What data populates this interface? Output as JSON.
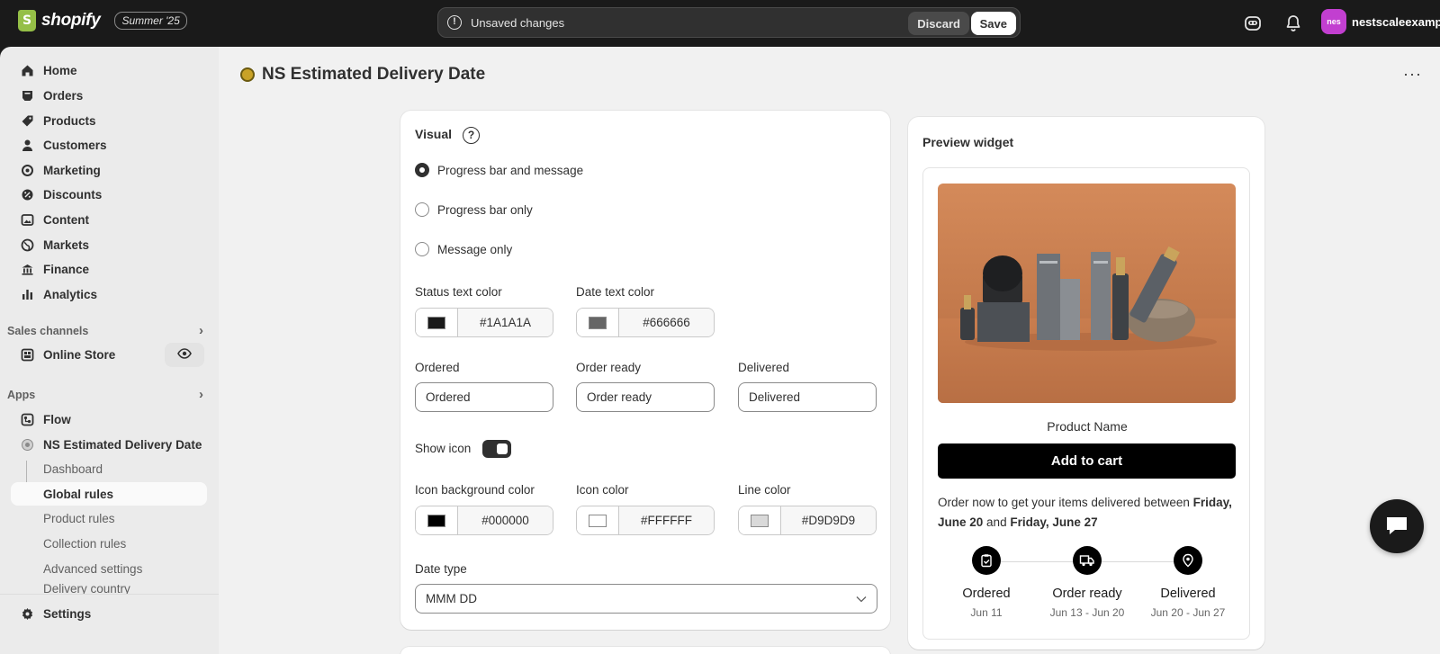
{
  "topbar": {
    "logo_text": "shopify",
    "edition": "Summer '25",
    "unsaved_message": "Unsaved changes",
    "discard_label": "Discard",
    "save_label": "Save",
    "store_avatar": "nes",
    "store_name": "nestscaleexample"
  },
  "sidebar": {
    "items": [
      {
        "label": "Home",
        "icon": "home-icon"
      },
      {
        "label": "Orders",
        "icon": "orders-icon"
      },
      {
        "label": "Products",
        "icon": "tag-icon"
      },
      {
        "label": "Customers",
        "icon": "person-icon"
      },
      {
        "label": "Marketing",
        "icon": "target-icon"
      },
      {
        "label": "Discounts",
        "icon": "discount-icon"
      },
      {
        "label": "Content",
        "icon": "content-icon"
      },
      {
        "label": "Markets",
        "icon": "globe-icon"
      },
      {
        "label": "Finance",
        "icon": "bank-icon"
      },
      {
        "label": "Analytics",
        "icon": "chart-icon"
      }
    ],
    "sales_channels_label": "Sales channels",
    "online_store_label": "Online Store",
    "apps_label": "Apps",
    "flow_label": "Flow",
    "app_label": "NS Estimated Delivery Date",
    "sub_items": [
      "Dashboard",
      "Global rules",
      "Product rules",
      "Collection rules",
      "Advanced settings",
      "Delivery country"
    ],
    "settings_label": "Settings"
  },
  "page": {
    "title": "NS Estimated Delivery Date"
  },
  "visual": {
    "heading": "Visual",
    "options": [
      "Progress bar and message",
      "Progress bar only",
      "Message only"
    ],
    "selected": 0,
    "status_text_color_label": "Status text color",
    "status_text_color": "#1A1A1A",
    "date_text_color_label": "Date text color",
    "date_text_color": "#666666",
    "ordered_label": "Ordered",
    "ordered_value": "Ordered",
    "order_ready_label": "Order ready",
    "order_ready_value": "Order ready",
    "delivered_label": "Delivered",
    "delivered_value": "Delivered",
    "show_icon_label": "Show icon",
    "show_icon_on": true,
    "icon_bg_color_label": "Icon background color",
    "icon_bg_color": "#000000",
    "icon_color_label": "Icon color",
    "icon_color": "#FFFFFF",
    "line_color_label": "Line color",
    "line_color": "#D9D9D9",
    "date_type_label": "Date type",
    "date_type_value": "MMM DD"
  },
  "preview": {
    "heading": "Preview widget",
    "product_name": "Product Name",
    "add_to_cart": "Add to cart",
    "message_prefix": "Order now to get your items delivered between",
    "date_start": "Friday, June 20",
    "message_and": "and",
    "date_end": "Friday, June 27",
    "steps": [
      {
        "name": "Ordered",
        "date": "Jun 11",
        "icon": "clipboard-icon"
      },
      {
        "name": "Order ready",
        "date": "Jun 13 - Jun 20",
        "icon": "truck-icon"
      },
      {
        "name": "Delivered",
        "date": "Jun 20 - Jun 27",
        "icon": "location-pin-icon"
      }
    ]
  },
  "colors": {
    "topbar_bg": "#1a1a1a",
    "sidebar_bg": "#ebebeb",
    "main_bg": "#f1f1f1",
    "avatar_bg": "#c23fd0"
  }
}
